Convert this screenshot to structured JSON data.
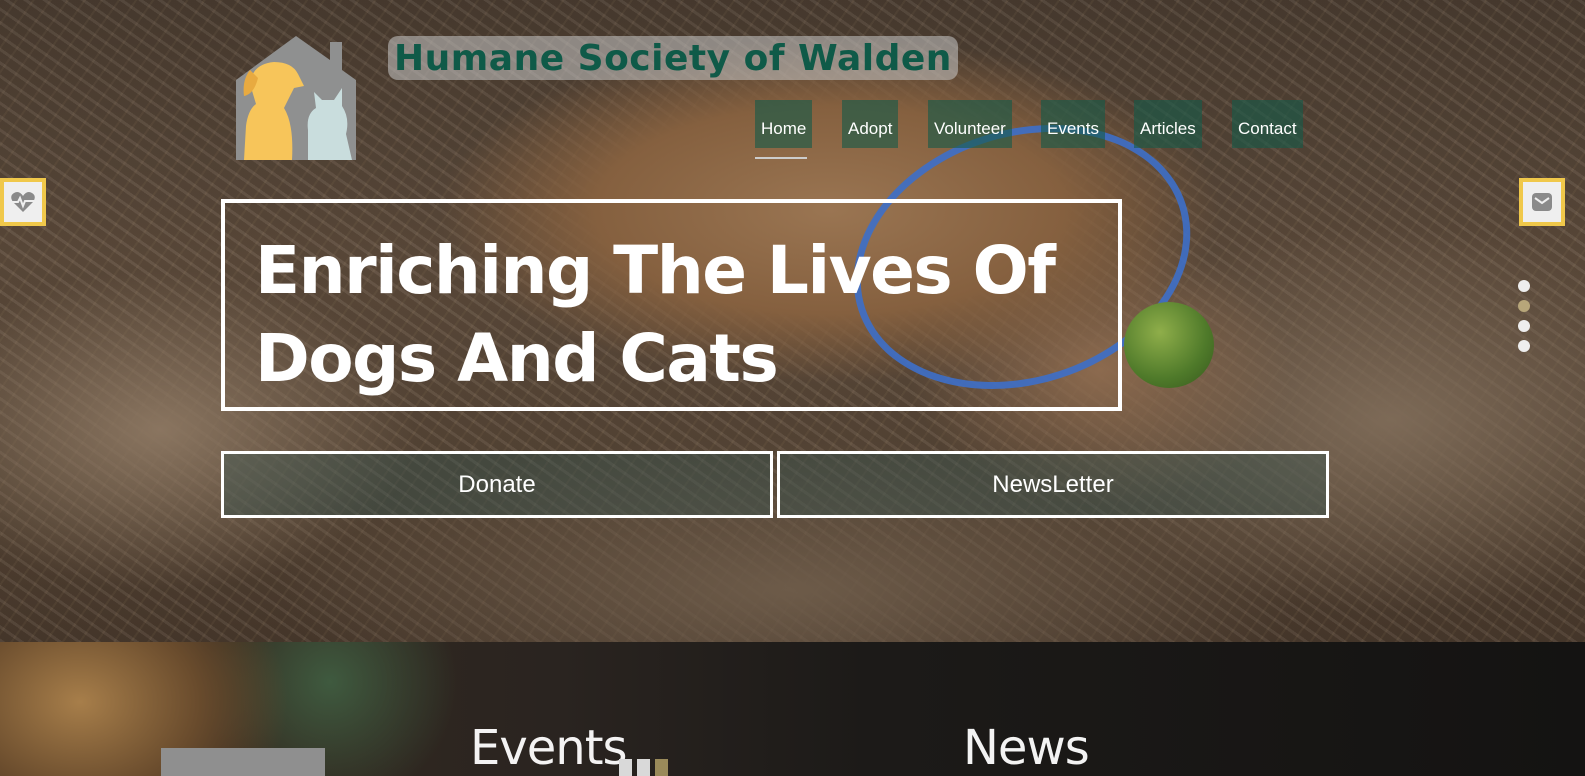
{
  "site": {
    "title": "Humane Society of Walden",
    "logo_icon": "dog-cat-house-logo"
  },
  "nav": {
    "items": [
      {
        "label": "Home",
        "active": true
      },
      {
        "label": "Adopt"
      },
      {
        "label": "Volunteer"
      },
      {
        "label": "Events"
      },
      {
        "label": "Articles"
      },
      {
        "label": "Contact"
      }
    ]
  },
  "hero": {
    "headline": "Enriching The Lives Of\nDogs And Cats",
    "buttons": {
      "donate": "Donate",
      "newsletter": "NewsLetter"
    },
    "slider": {
      "count": 4,
      "active_index": 1
    }
  },
  "side_buttons": {
    "left_icon": "heartbeat-icon",
    "right_icon": "envelope-icon"
  },
  "sections": {
    "events": "Events",
    "news": "News"
  },
  "colors": {
    "accent_yellow": "#f0c84a",
    "brand_green": "#0f5a48",
    "nav_bg": "#165a48",
    "logo_dog": "#f7c55a",
    "logo_cat": "#c9dddd"
  }
}
